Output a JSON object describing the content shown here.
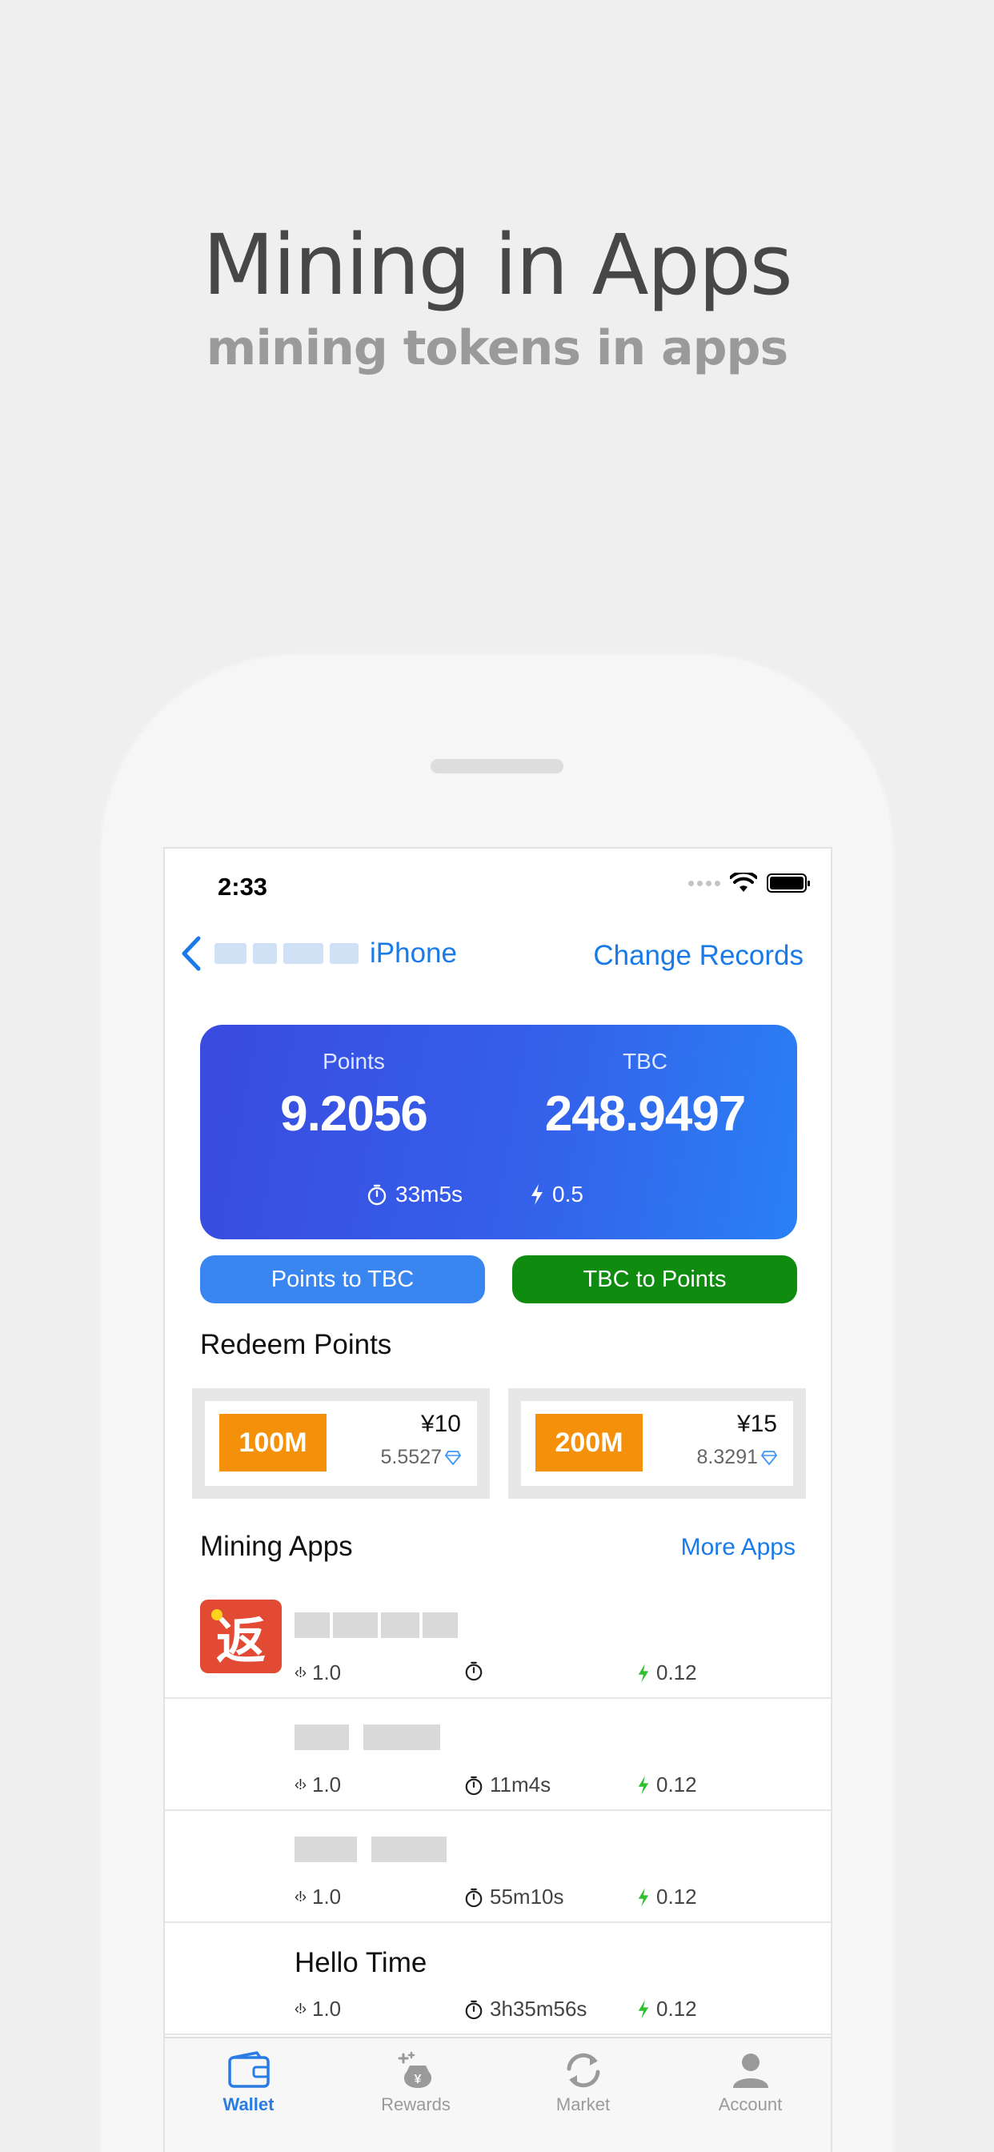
{
  "promo": {
    "headline": "Mining in Apps",
    "subheadline": "mining tokens in apps"
  },
  "status_bar": {
    "time": "2:33"
  },
  "nav": {
    "back_label": "iPhone",
    "right_action": "Change Records"
  },
  "wallet": {
    "points_label": "Points",
    "points_value": "9.2056",
    "tbc_label": "TBC",
    "tbc_value": "248.9497",
    "timer": "33m5s",
    "rate": "0.5",
    "colors": {
      "gradient_start": "#3a4bdf",
      "gradient_end": "#2a80f4"
    }
  },
  "actions": {
    "points_to_tbc": "Points to TBC",
    "tbc_to_points": "TBC to Points"
  },
  "redeem": {
    "title": "Redeem Points",
    "items": [
      {
        "tag": "100M",
        "price": "¥10",
        "tbc": "5.5527"
      },
      {
        "tag": "200M",
        "price": "¥15",
        "tbc": "8.3291"
      }
    ]
  },
  "mining_apps": {
    "title": "Mining Apps",
    "more_label": "More Apps",
    "items": [
      {
        "name": "",
        "version": "1.0",
        "time": "",
        "rate": "0.12"
      },
      {
        "name": "",
        "version": "1.0",
        "time": "11m4s",
        "rate": "0.12"
      },
      {
        "name": "",
        "version": "1.0",
        "time": "55m10s",
        "rate": "0.12"
      },
      {
        "name": "Hello Time",
        "version": "1.0",
        "time": "3h35m56s",
        "rate": "0.12"
      }
    ]
  },
  "tabbar": {
    "items": [
      {
        "label": "Wallet",
        "icon": "wallet-icon",
        "active": true
      },
      {
        "label": "Rewards",
        "icon": "rewards-icon",
        "active": false
      },
      {
        "label": "Market",
        "icon": "market-icon",
        "active": false
      },
      {
        "label": "Account",
        "icon": "account-icon",
        "active": false
      }
    ]
  },
  "colors": {
    "accent": "#1a7ae8",
    "green_button": "#0f8c10",
    "blue_button": "#3a86f0",
    "redeem_tag": "#f5900a",
    "rate_bolt": "#2fbf2f"
  }
}
